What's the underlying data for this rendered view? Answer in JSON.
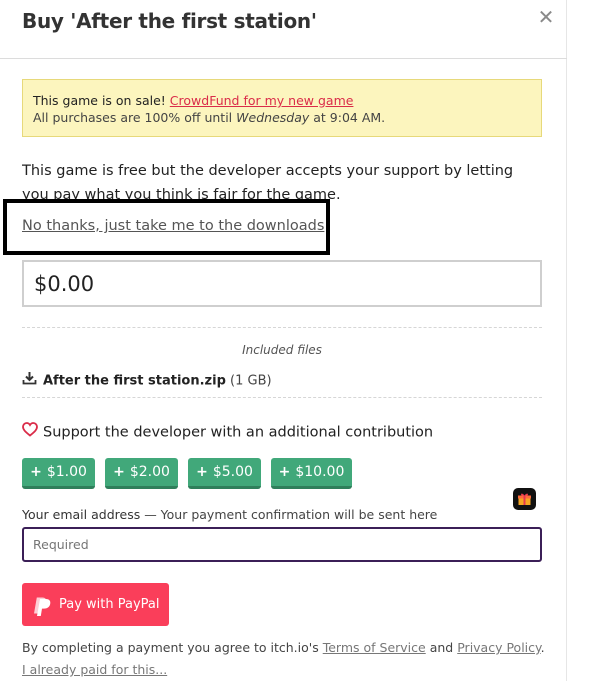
{
  "dialog": {
    "title": "Buy 'After the first station'",
    "close_glyph": "✕"
  },
  "sale": {
    "prefix": "This game is on sale!",
    "link_text": "CrowdFund for my new game",
    "line2_prefix": "All purchases are 100% off until",
    "line2_day": "Wednesday",
    "line2_suffix": "at 9:04 AM."
  },
  "intro": {
    "text": "This game is free but the developer accepts your support by letting you pay what you think is fair for the game."
  },
  "no_thanks_link": "No thanks, just take me to the downloads",
  "price": {
    "value": "$0.00"
  },
  "included": {
    "label": "Included files",
    "files": [
      {
        "name": "After the first station.zip",
        "size": "(1 GB)"
      }
    ]
  },
  "support": {
    "label": "Support the developer with an additional contribution",
    "buttons": [
      {
        "label": "$1.00"
      },
      {
        "label": "$2.00"
      },
      {
        "label": "$5.00"
      },
      {
        "label": "$10.00"
      }
    ],
    "plus_glyph": "+"
  },
  "email": {
    "label": "Your email address",
    "hint": "— Your payment confirmation will be sent here",
    "placeholder": "Required"
  },
  "paypal": {
    "label": "Pay with PayPal"
  },
  "terms": {
    "prefix": "By completing a payment you agree to itch.io's",
    "tos": "Terms of Service",
    "and": "and",
    "privacy": "Privacy Policy",
    "suffix": "."
  },
  "already_paid": "I already paid for this...",
  "colors": {
    "accent_red": "#da2c49",
    "button_green": "#41a87a",
    "paypal_red": "#fa3e5a",
    "banner_yellow": "#fcf5be",
    "email_border": "#3b1f57"
  },
  "icons": {
    "close": "close-icon",
    "download": "download-icon",
    "heart": "heart-icon",
    "paypal": "paypal-icon",
    "gift": "gift-icon"
  }
}
